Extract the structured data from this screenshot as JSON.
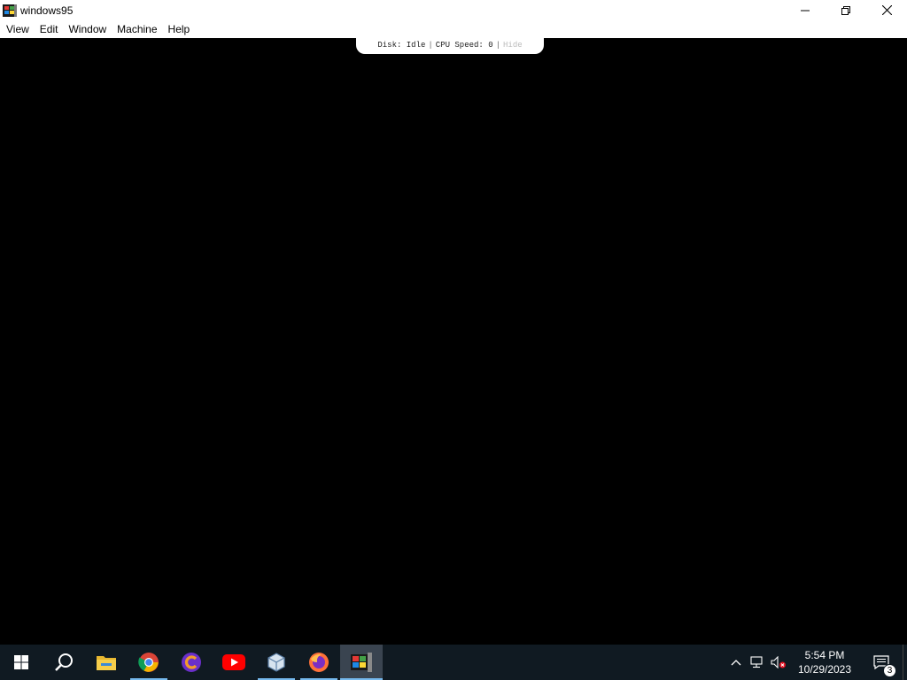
{
  "window": {
    "title": "windows95",
    "controls": {
      "minimize": "minimize-icon",
      "restore": "restore-icon",
      "close": "close-icon"
    }
  },
  "menu": {
    "items": [
      "View",
      "Edit",
      "Window",
      "Machine",
      "Help"
    ]
  },
  "status": {
    "disk_label": "Disk: Idle",
    "cpu_label": "CPU Speed: 0",
    "hide_label": "Hide"
  },
  "taskbar": {
    "apps": [
      {
        "name": "start",
        "icon": "windows-start-icon"
      },
      {
        "name": "search",
        "icon": "search-icon"
      },
      {
        "name": "file-explorer",
        "icon": "folder-icon"
      },
      {
        "name": "chrome",
        "icon": "chrome-icon"
      },
      {
        "name": "app-c",
        "icon": "c-app-icon"
      },
      {
        "name": "youtube",
        "icon": "youtube-icon"
      },
      {
        "name": "virtualbox",
        "icon": "virtualbox-icon"
      },
      {
        "name": "firefox",
        "icon": "firefox-icon"
      },
      {
        "name": "windows95",
        "icon": "windows95-icon"
      }
    ],
    "clock": {
      "time": "5:54 PM",
      "date": "10/29/2023"
    },
    "notifications": {
      "count": "3"
    }
  },
  "colors": {
    "taskbar": "#101a22",
    "accent": "#76b9ed",
    "screen": "#000000"
  }
}
